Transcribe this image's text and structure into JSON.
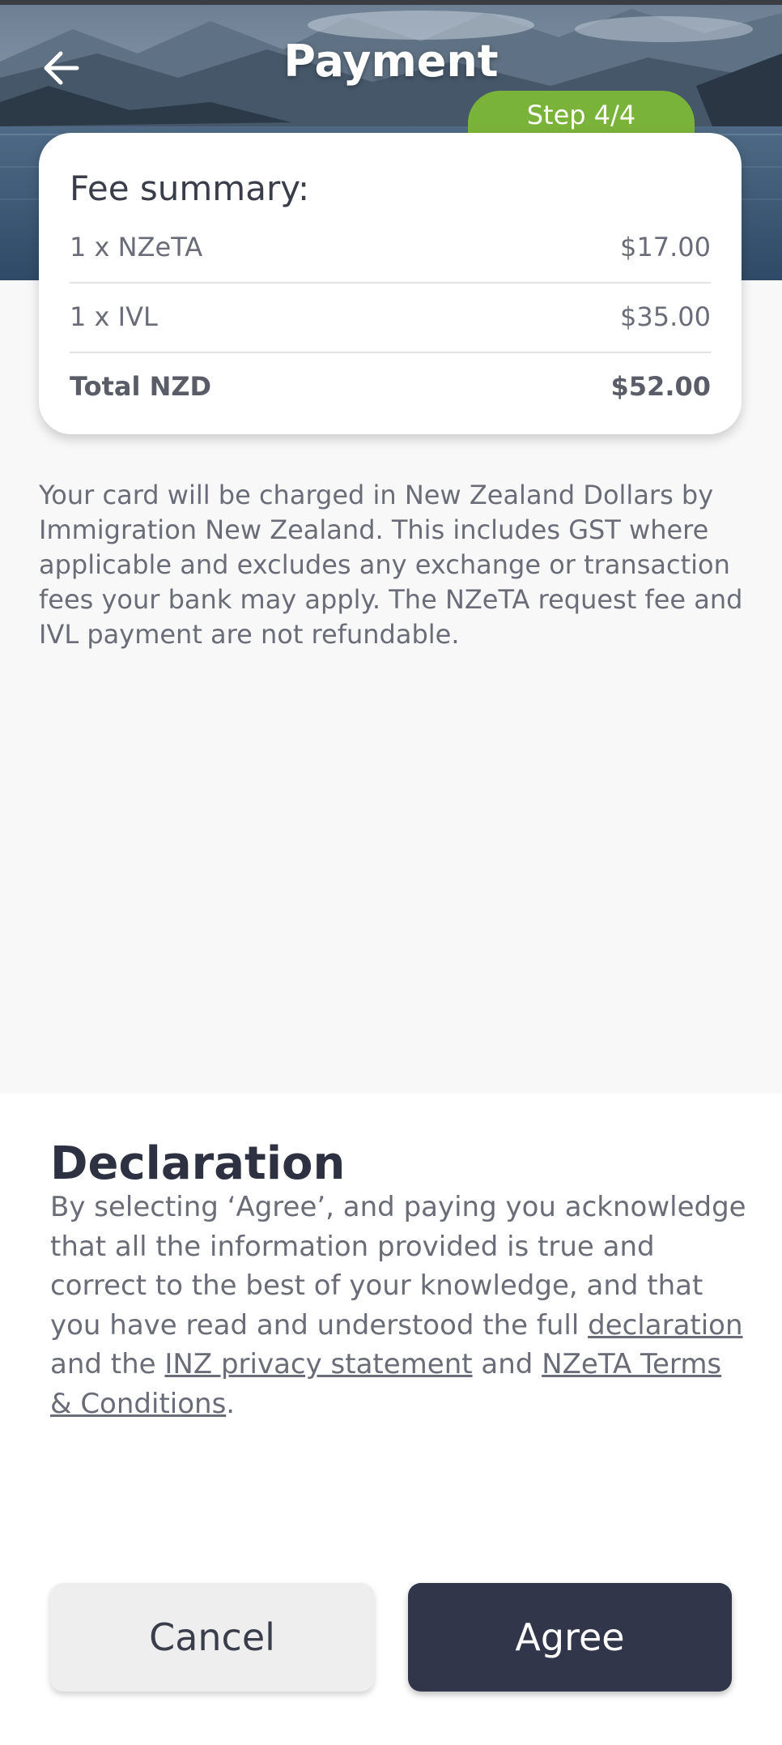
{
  "header": {
    "title": "Payment",
    "step": "Step 4/4",
    "back_icon": "arrow-left-icon"
  },
  "fee_summary": {
    "title": "Fee summary:",
    "rows": [
      {
        "label": "1 x NZeTA",
        "amount": "$17.00"
      },
      {
        "label": "1 x IVL",
        "amount": "$35.00"
      }
    ],
    "total": {
      "label": "Total NZD",
      "amount": "$52.00"
    }
  },
  "charge_note": "Your card will be charged in New Zealand Dollars by Immigration New Zealand. This includes GST where applicable and excludes any exchange or transaction fees your bank may apply. The NZeTA request fee and IVL payment are not refundable.",
  "declaration": {
    "title": "Declaration",
    "text_intro": "By selecting ‘Agree’, and paying you acknowledge that all the information provided is true and correct to the best of your knowledge, and that you have read and understood the full ",
    "link_declaration": "declaration",
    "text_and_the": " and the ",
    "link_privacy": "INZ privacy statement",
    "text_and": " and ",
    "link_terms": "NZeTA Terms & Conditions",
    "text_end": "."
  },
  "buttons": {
    "cancel": "Cancel",
    "agree": "Agree"
  },
  "colors": {
    "step_badge": "#7ab33a",
    "agree_button": "#32364a",
    "cancel_button": "#eeeeee",
    "background": "#f8f8f8"
  }
}
